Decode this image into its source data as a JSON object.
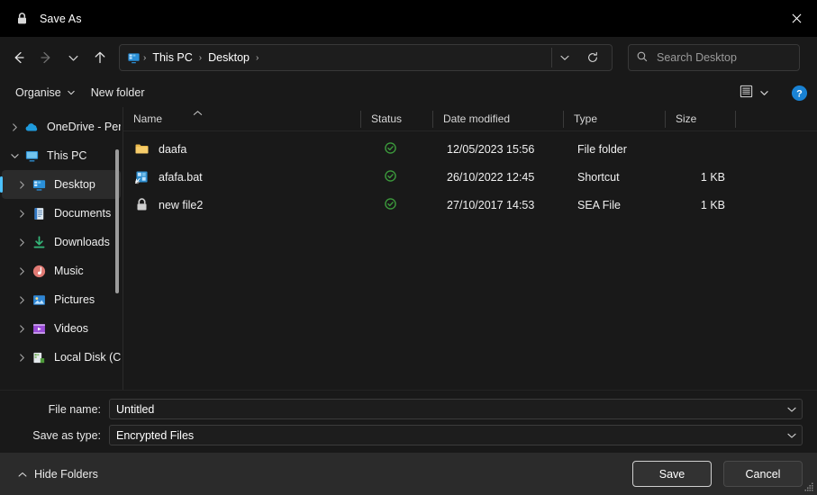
{
  "window": {
    "title": "Save As",
    "title_icon": "lock-icon",
    "close_label": "✕"
  },
  "nav": {
    "back": "back-arrow-icon",
    "forward": "forward-arrow-icon",
    "recent": "chevron-down-icon",
    "up": "up-arrow-icon"
  },
  "address": {
    "leading_icon": "desktop-icon",
    "crumbs": [
      "This PC",
      "Desktop"
    ],
    "separator": "›",
    "trailing_separator": "›",
    "dropdown_icon": "chevron-down-icon",
    "refresh_icon": "refresh-icon"
  },
  "search": {
    "icon": "search-icon",
    "placeholder": "Search Desktop",
    "value": ""
  },
  "toolbar": {
    "organise_label": "Organise",
    "organise_caret": "▼",
    "new_folder_label": "New folder",
    "view_icon": "list-view-icon",
    "view_caret": "▼",
    "help_icon": "help-icon",
    "help_label": "?"
  },
  "sidebar": {
    "items": [
      {
        "label": "OneDrive - Perso",
        "icon": "onedrive-cloud-icon",
        "expander": "chevron-right",
        "indent": 0,
        "selected": false
      },
      {
        "label": "This PC",
        "icon": "this-pc-monitor-icon",
        "expander": "chevron-down",
        "indent": 0,
        "selected": false
      },
      {
        "label": "Desktop",
        "icon": "desktop-icon",
        "expander": "chevron-right",
        "indent": 1,
        "selected": true
      },
      {
        "label": "Documents",
        "icon": "documents-icon",
        "expander": "chevron-right",
        "indent": 1,
        "selected": false
      },
      {
        "label": "Downloads",
        "icon": "downloads-icon",
        "expander": "chevron-right",
        "indent": 1,
        "selected": false
      },
      {
        "label": "Music",
        "icon": "music-icon",
        "expander": "chevron-right",
        "indent": 1,
        "selected": false
      },
      {
        "label": "Pictures",
        "icon": "pictures-icon",
        "expander": "chevron-right",
        "indent": 1,
        "selected": false
      },
      {
        "label": "Videos",
        "icon": "videos-icon",
        "expander": "chevron-right",
        "indent": 1,
        "selected": false
      },
      {
        "label": "Local Disk  (C:)",
        "icon": "local-disk-icon",
        "expander": "chevron-right",
        "indent": 1,
        "selected": false
      }
    ]
  },
  "filelist": {
    "columns": [
      "Name",
      "Status",
      "Date modified",
      "Type",
      "Size"
    ],
    "sort_column": "Name",
    "sort_caret": "˄",
    "rows": [
      {
        "name": "daafa",
        "icon": "folder-icon",
        "status": "synced-check-icon",
        "date": "12/05/2023 15:56",
        "type": "File folder",
        "size": ""
      },
      {
        "name": "afafa.bat",
        "icon": "shortcut-icon",
        "status": "synced-check-icon",
        "date": "26/10/2022 12:45",
        "type": "Shortcut",
        "size": "1 KB"
      },
      {
        "name": "new file2",
        "icon": "lock-file-icon",
        "status": "synced-check-icon",
        "date": "27/10/2017 14:53",
        "type": "SEA File",
        "size": "1 KB"
      }
    ]
  },
  "form": {
    "filename_label": "File name:",
    "filename_value": "Untitled",
    "filetype_label": "Save as type:",
    "filetype_value": "Encrypted Files",
    "dropdown_icon": "chevron-down-icon"
  },
  "footer": {
    "hide_folders_label": "Hide Folders",
    "hide_folders_caret": "˄",
    "save_label": "Save",
    "cancel_label": "Cancel"
  },
  "colors": {
    "accent": "#4cc2ff",
    "window_bg": "#191919",
    "titlebar_bg": "#000000",
    "footer_bg": "#2b2b2b",
    "status_green": "#3aa83a",
    "folder_yellow": "#f0c050"
  }
}
